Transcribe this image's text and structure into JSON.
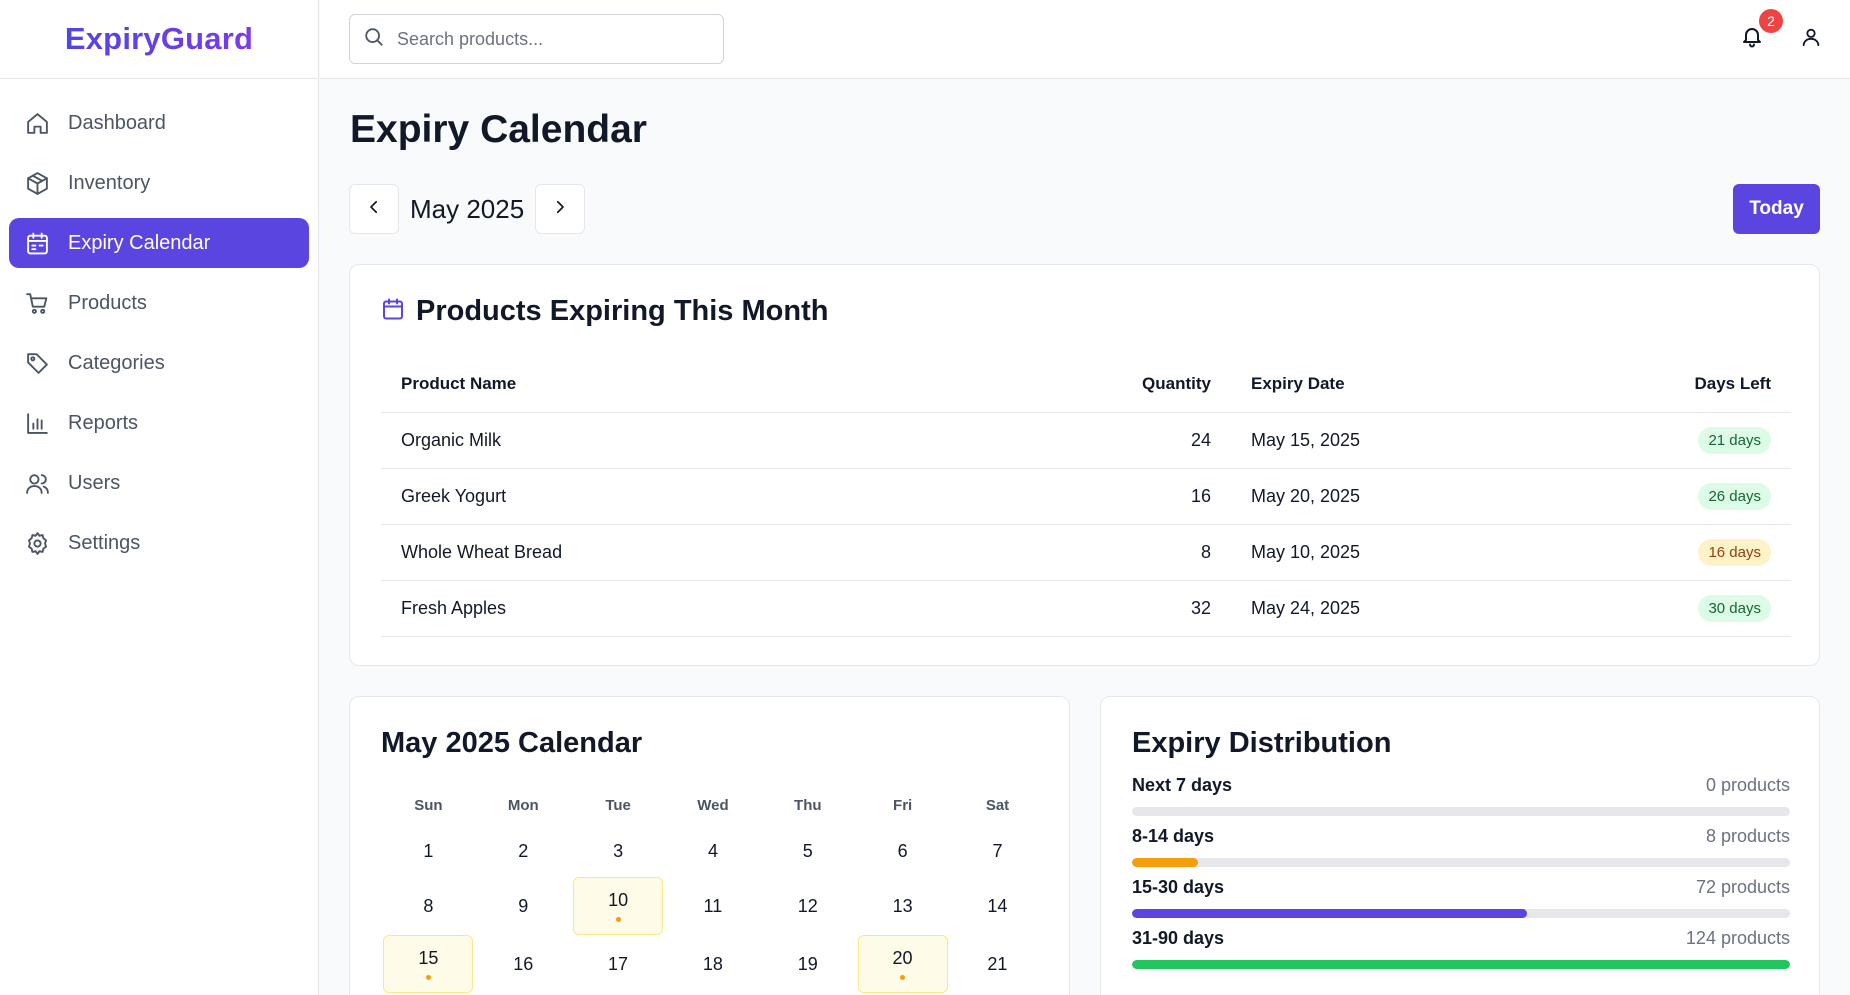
{
  "brand": {
    "name": "ExpiryGuard"
  },
  "sidebar": {
    "items": [
      {
        "label": "Dashboard",
        "icon": "home-icon",
        "active": false
      },
      {
        "label": "Inventory",
        "icon": "box-icon",
        "active": false
      },
      {
        "label": "Expiry Calendar",
        "icon": "calendar-icon",
        "active": true
      },
      {
        "label": "Products",
        "icon": "cart-icon",
        "active": false
      },
      {
        "label": "Categories",
        "icon": "tag-icon",
        "active": false
      },
      {
        "label": "Reports",
        "icon": "bar-chart-icon",
        "active": false
      },
      {
        "label": "Users",
        "icon": "users-icon",
        "active": false
      },
      {
        "label": "Settings",
        "icon": "gear-icon",
        "active": false
      }
    ]
  },
  "header": {
    "search_placeholder": "Search products...",
    "notification_count": "2"
  },
  "page": {
    "title": "Expiry Calendar",
    "month_label": "May 2025",
    "today_label": "Today"
  },
  "expiring": {
    "title": "Products Expiring This Month",
    "columns": [
      "Product Name",
      "Quantity",
      "Expiry Date",
      "Days Left"
    ],
    "rows": [
      {
        "name": "Organic Milk",
        "quantity": "24",
        "date": "May 15, 2025",
        "days": "21 days",
        "status": "green"
      },
      {
        "name": "Greek Yogurt",
        "quantity": "16",
        "date": "May 20, 2025",
        "days": "26 days",
        "status": "green"
      },
      {
        "name": "Whole Wheat Bread",
        "quantity": "8",
        "date": "May 10, 2025",
        "days": "16 days",
        "status": "amber"
      },
      {
        "name": "Fresh Apples",
        "quantity": "32",
        "date": "May 24, 2025",
        "days": "30 days",
        "status": "green"
      }
    ]
  },
  "calendar": {
    "title": "May 2025 Calendar",
    "weekdays": [
      "Sun",
      "Mon",
      "Tue",
      "Wed",
      "Thu",
      "Fri",
      "Sat"
    ],
    "weeks": [
      [
        "1",
        "2",
        "3",
        "4",
        "5",
        "6",
        "7"
      ],
      [
        "8",
        "9",
        "10",
        "11",
        "12",
        "13",
        "14"
      ],
      [
        "15",
        "16",
        "17",
        "18",
        "19",
        "20",
        "21"
      ]
    ],
    "highlighted_days": [
      "10",
      "15",
      "20"
    ]
  },
  "distribution": {
    "title": "Expiry Distribution",
    "rows": [
      {
        "label": "Next 7 days",
        "count": "0 products",
        "fraction": 0.0,
        "color": "#f59e0b"
      },
      {
        "label": "8-14 days",
        "count": "8 products",
        "fraction": 0.1,
        "color": "#f59e0b"
      },
      {
        "label": "15-30 days",
        "count": "72 products",
        "fraction": 0.6,
        "color": "#5b45e0"
      },
      {
        "label": "31-90 days",
        "count": "124 products",
        "fraction": 1.0,
        "color": "#22c55e"
      }
    ]
  },
  "colors": {
    "accent": "#5b45e0",
    "warning": "#f59e0b",
    "danger": "#ef4444"
  }
}
